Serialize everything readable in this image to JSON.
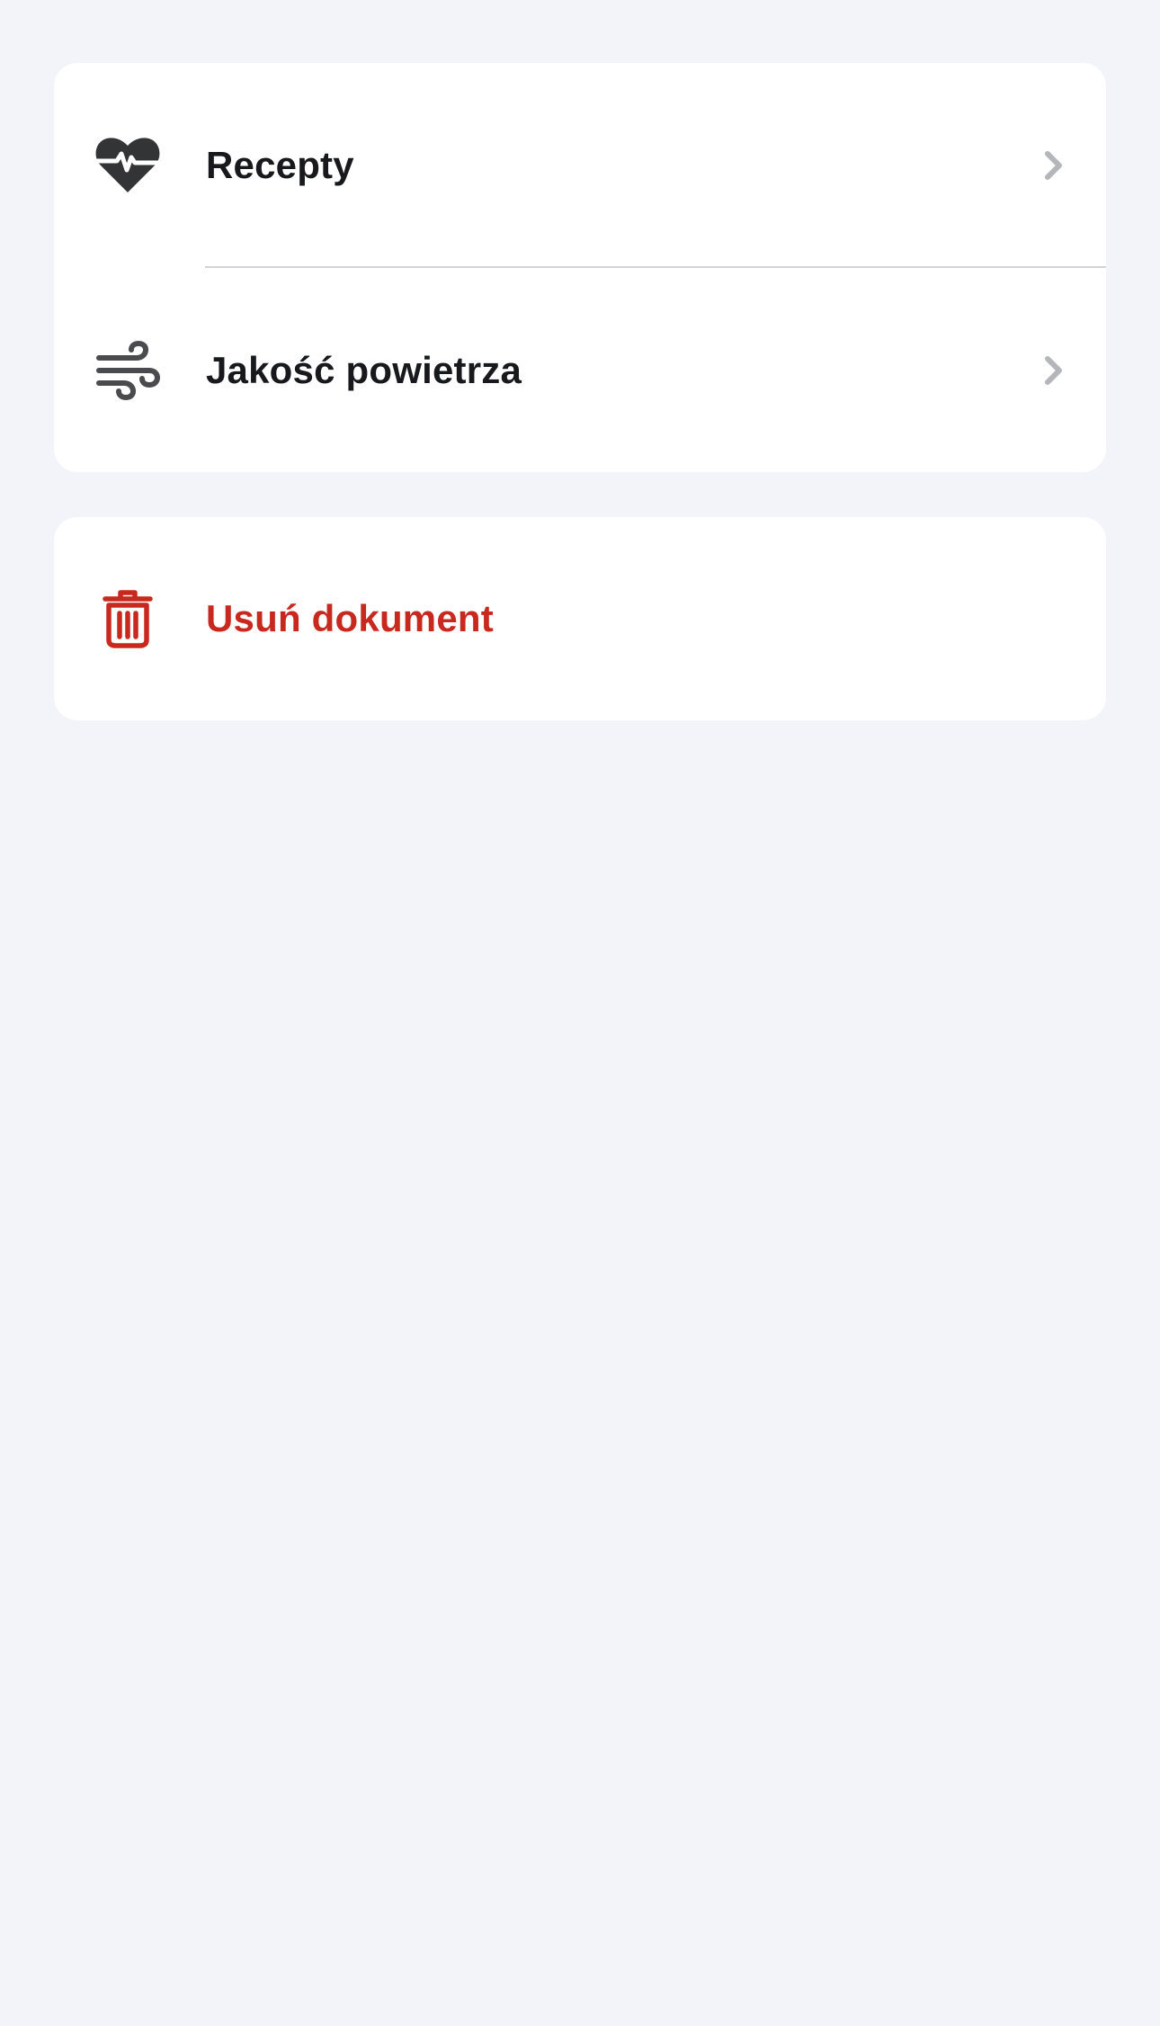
{
  "colors": {
    "background": "#F3F4F9",
    "card": "#FFFFFF",
    "text": "#17191C",
    "danger": "#C8281E",
    "chevron": "#B5B6BA",
    "divider": "#D2D3D6",
    "icon": "#333436"
  },
  "menu": {
    "items": [
      {
        "label": "Recepty",
        "icon": "heart-pulse-icon",
        "chevron": "chevron-right-icon"
      },
      {
        "label": "Jakość powietrza",
        "icon": "wind-icon",
        "chevron": "chevron-right-icon"
      }
    ]
  },
  "actions": {
    "delete": {
      "label": "Usuń dokument",
      "icon": "trash-icon"
    }
  }
}
